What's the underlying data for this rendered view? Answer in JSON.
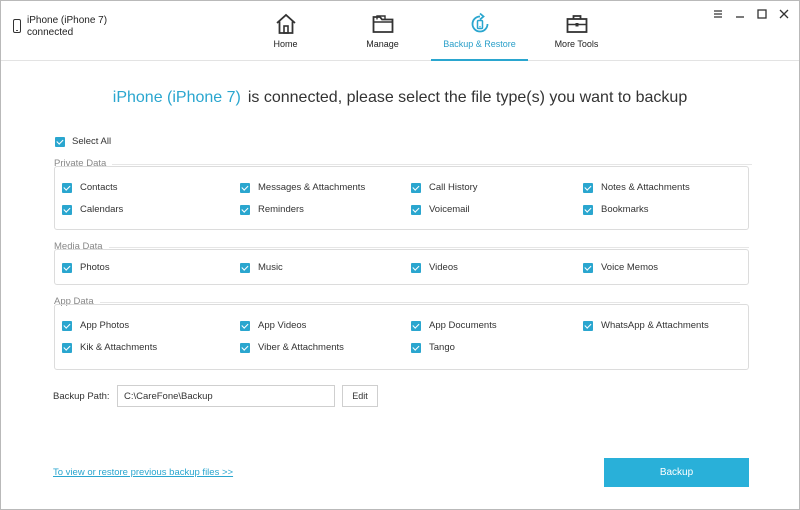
{
  "device": {
    "name_line": "iPhone (iPhone 7)",
    "status_line": "connected"
  },
  "nav": [
    {
      "label": "Home",
      "icon": "home-icon"
    },
    {
      "label": "Manage",
      "icon": "folder-icon"
    },
    {
      "label": "Backup & Restore",
      "icon": "backup-restore-icon",
      "active": true
    },
    {
      "label": "More Tools",
      "icon": "toolbox-icon"
    }
  ],
  "headline": {
    "device": "iPhone (iPhone 7)",
    "text": "is connected, please select the file type(s) you want to backup"
  },
  "select_all": "Select All",
  "groups": {
    "private": {
      "title": "Private Data",
      "items": [
        "Contacts",
        "Messages & Attachments",
        "Call History",
        "Notes & Attachments",
        "Calendars",
        "Reminders",
        "Voicemail",
        "Bookmarks"
      ]
    },
    "media": {
      "title": "Media Data",
      "items": [
        "Photos",
        "Music",
        "Videos",
        "Voice Memos"
      ]
    },
    "app": {
      "title": "App Data",
      "items": [
        "App Photos",
        "App Videos",
        "App Documents",
        "WhatsApp & Attachments",
        "Kik & Attachments",
        "Viber & Attachments",
        "Tango"
      ]
    }
  },
  "backup_path": {
    "label": "Backup Path:",
    "value": "C:\\CareFone\\Backup",
    "edit": "Edit"
  },
  "link": "To view or restore previous backup files >>",
  "backup_button": "Backup",
  "colors": {
    "accent": "#2aa6cf",
    "button": "#29b0d9"
  }
}
